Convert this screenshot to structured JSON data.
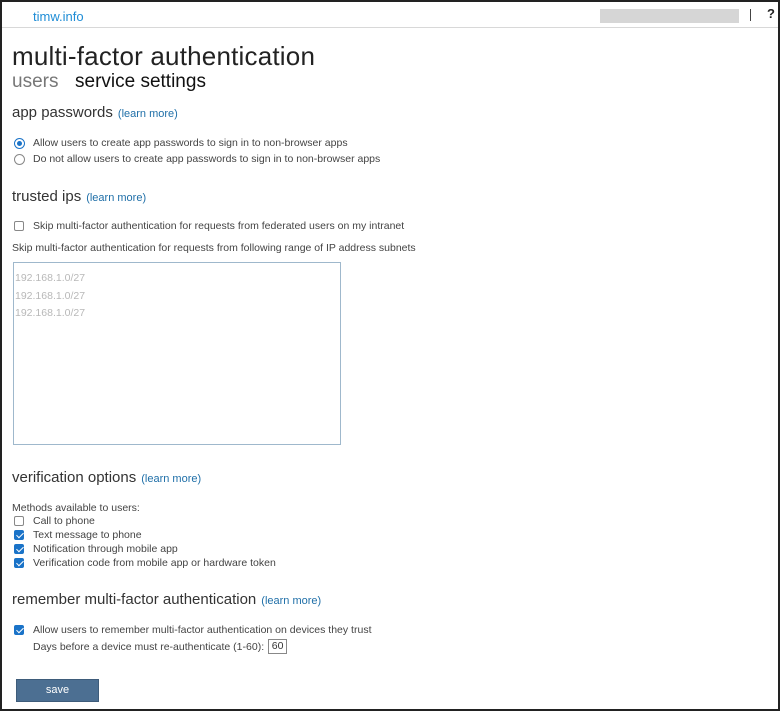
{
  "header": {
    "brand": "timw.info",
    "separator": "|",
    "help": "?"
  },
  "page": {
    "title": "multi-factor authentication"
  },
  "tabs": {
    "users": "users",
    "service_settings": "service settings"
  },
  "app_passwords": {
    "heading": "app passwords",
    "learn_more": "(learn more)",
    "allow_label": "Allow users to create app passwords to sign in to non-browser apps",
    "deny_label": "Do not allow users to create app passwords to sign in to non-browser apps",
    "selected": "allow"
  },
  "trusted_ips": {
    "heading": "trusted ips",
    "learn_more": "(learn more)",
    "skip_federated_label": "Skip multi-factor authentication for requests from federated users on my intranet",
    "skip_federated_checked": false,
    "subnets_label": "Skip multi-factor authentication for requests from following range of IP address subnets",
    "placeholder_lines": [
      "192.168.1.0/27",
      "192.168.1.0/27",
      "192.168.1.0/27"
    ]
  },
  "verification": {
    "heading": "verification options",
    "learn_more": "(learn more)",
    "methods_label": "Methods available to users:",
    "methods": [
      {
        "label": "Call to phone",
        "checked": false
      },
      {
        "label": "Text message to phone",
        "checked": true
      },
      {
        "label": "Notification through mobile app",
        "checked": true
      },
      {
        "label": "Verification code from mobile app or hardware token",
        "checked": true
      }
    ]
  },
  "remember": {
    "heading": "remember multi-factor authentication",
    "learn_more": "(learn more)",
    "allow_label": "Allow users to remember multi-factor authentication on devices they trust",
    "allow_checked": true,
    "days_label": "Days before a device must re-authenticate (1-60):",
    "days_value": "60"
  },
  "actions": {
    "save_label": "save"
  }
}
